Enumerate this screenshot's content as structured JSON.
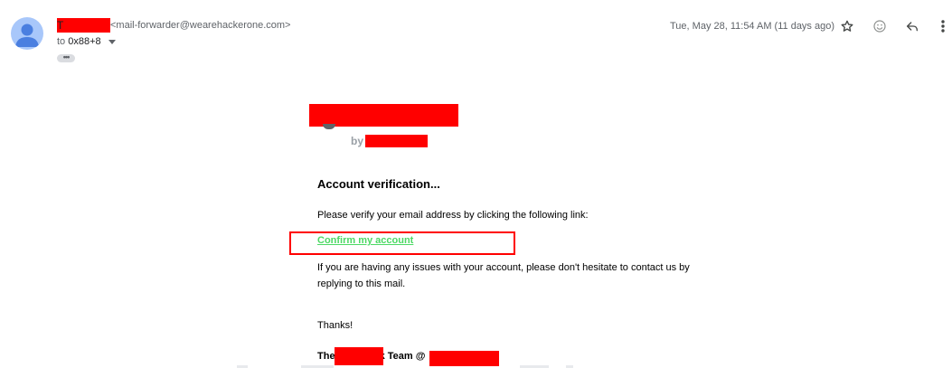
{
  "header": {
    "sender_name_visible": "T",
    "sender_email": "<mail-forwarder@wearehackerone.com>",
    "to_prefix": "to",
    "recipient": "0x88+8",
    "more_chip": "•••",
    "date": "Tue, May 28, 11:54 AM (11 days ago)"
  },
  "actions": {
    "icons": [
      "star-icon",
      "emoji-icon",
      "reply-icon",
      "more-vert-icon"
    ]
  },
  "body": {
    "by_label": "by",
    "heading": "Account verification...",
    "verify_text": "Please verify your email address by clicking the following link:",
    "confirm_link": "Confirm my account",
    "issues_text": "If you are having any issues with your account, please don't hesitate to contact us by replying to this mail.",
    "thanks": "Thanks!",
    "team_prefix": "The",
    "team_middle": "k Team @"
  },
  "colors": {
    "redaction": "#ff0000",
    "link": "#4cd964",
    "avatar_bg": "#a8c7fa",
    "avatar_fg": "#4285f4"
  }
}
